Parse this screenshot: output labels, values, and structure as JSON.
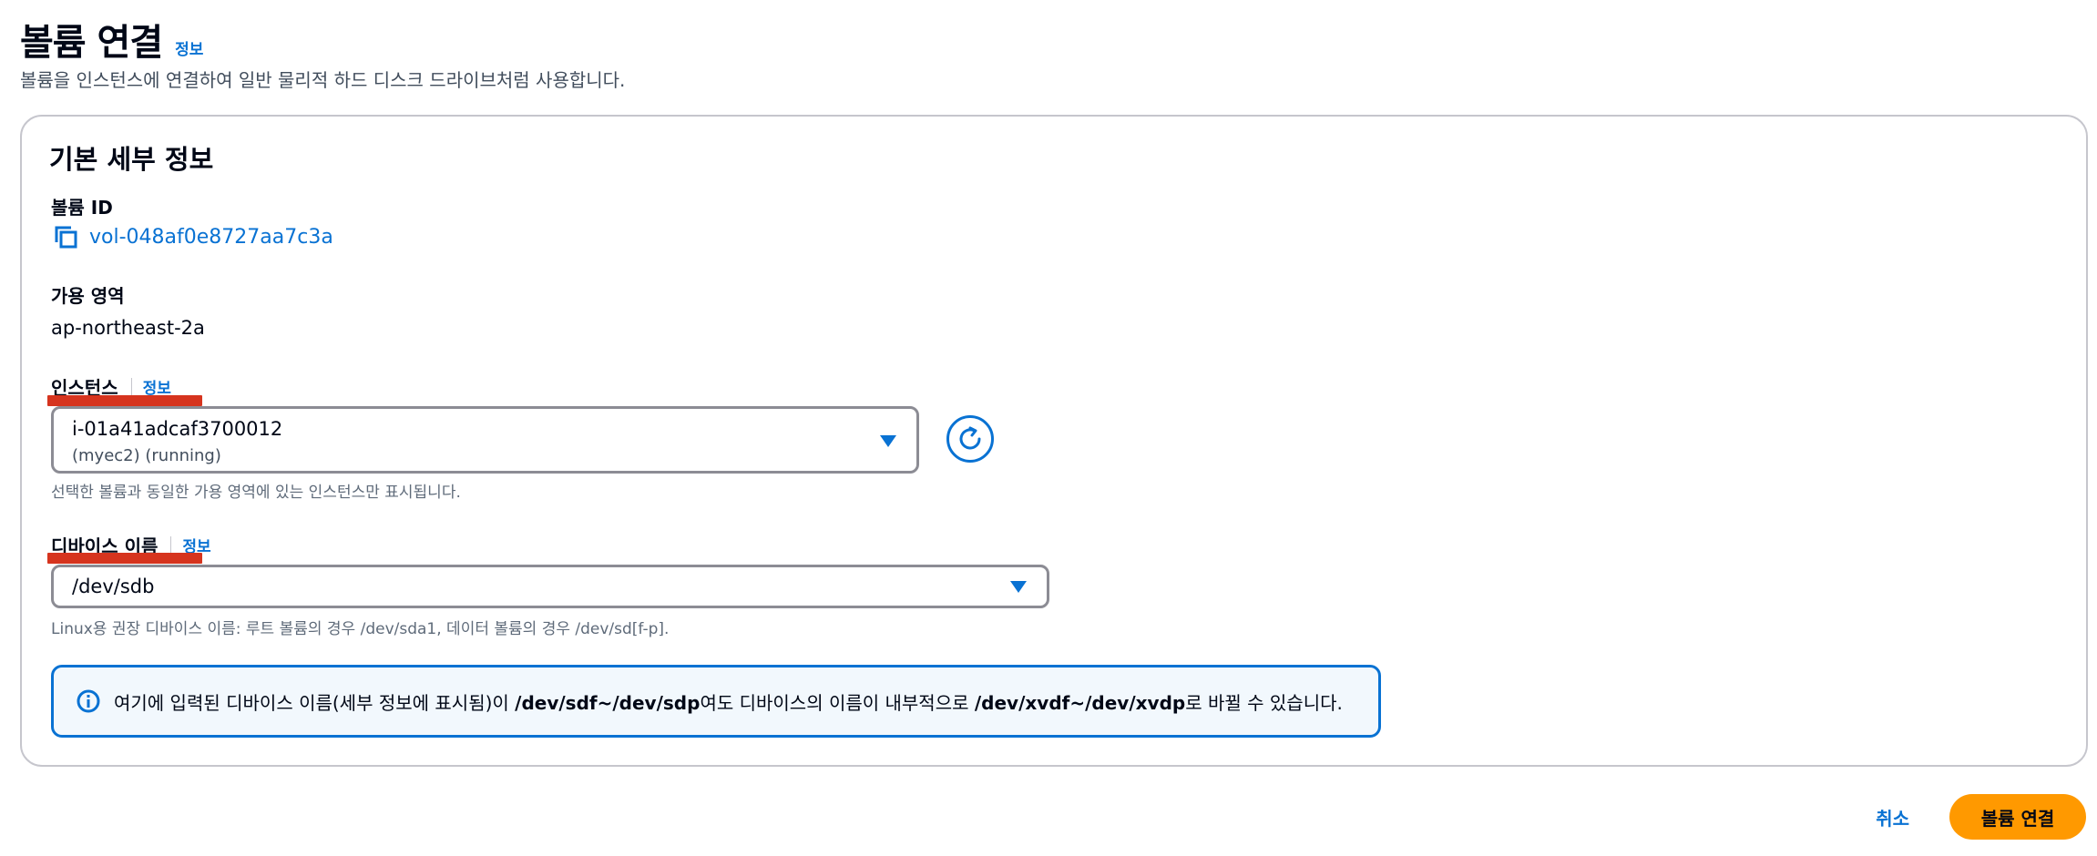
{
  "header": {
    "title": "볼륨 연결",
    "info_label": "정보",
    "description": "볼륨을 인스턴스에 연결하여 일반 물리적 하드 디스크 드라이브처럼 사용합니다."
  },
  "basic_details": {
    "title": "기본 세부 정보",
    "volume_id": {
      "label": "볼륨 ID",
      "value": "vol-048af0e8727aa7c3a",
      "icon": "copy-icon"
    },
    "availability_zone": {
      "label": "가용 영역",
      "value": "ap-northeast-2a"
    },
    "instance": {
      "label": "인스턴스",
      "info_label": "정보",
      "selected_id": "i-01a41adcaf3700012",
      "selected_detail": "(myec2) (running)",
      "hint": "선택한 볼륨과 동일한 가용 영역에 있는 인스턴스만 표시됩니다.",
      "refresh_icon": "refresh-icon"
    },
    "device_name": {
      "label": "디바이스 이름",
      "info_label": "정보",
      "value": "/dev/sdb",
      "hint": "Linux용 권장 디바이스 이름: 루트 볼륨의 경우 /dev/sda1, 데이터 볼륨의 경우 /dev/sd[f-p]."
    },
    "alert": {
      "icon": "info-icon",
      "text_1": "여기에 입력된 디바이스 이름(세부 정보에 표시됨)이 ",
      "bold_1": "/dev/sdf~/dev/sdp",
      "text_2": "여도 디바이스의 이름이 내부적으로 ",
      "bold_2": "/dev/xvdf~/dev/xvdp",
      "text_3": "로 바뀔 수 있습니다."
    }
  },
  "footer": {
    "cancel_label": "취소",
    "submit_label": "볼륨 연결"
  },
  "colors": {
    "link": "#0972d3",
    "primary": "#ff9900",
    "annotation": "#d6341e"
  }
}
